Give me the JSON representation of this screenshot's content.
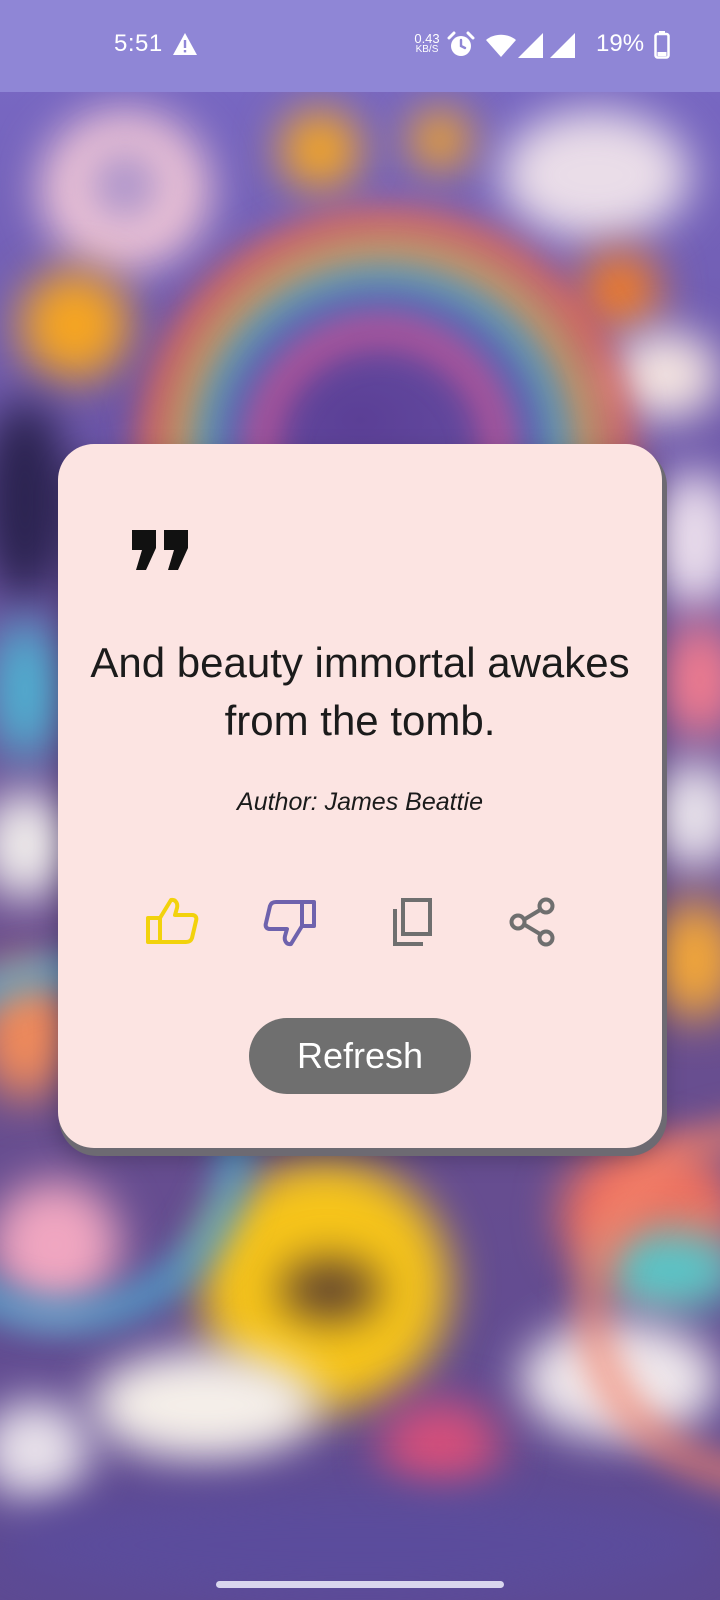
{
  "status_bar": {
    "time": "5:51",
    "net_speed_value": "0.43",
    "net_speed_unit": "KB/S",
    "battery_percent": "19%",
    "icons": [
      "warning-icon",
      "alarm-icon",
      "wifi-icon",
      "signal-icon",
      "signal-icon",
      "battery-icon"
    ]
  },
  "quote_card": {
    "quote_icon": "quote-icon",
    "quote": "And beauty immortal awakes from the tomb.",
    "author": "Author: James Beattie",
    "actions": [
      {
        "icon": "thumbs-up-icon",
        "color": "#f2d20c"
      },
      {
        "icon": "thumbs-down-icon",
        "color": "#6e62ad"
      },
      {
        "icon": "copy-icon",
        "color": "#6f6f6f"
      },
      {
        "icon": "share-icon",
        "color": "#6f6f6f"
      }
    ],
    "refresh_label": "Refresh"
  },
  "colors": {
    "card_background": "#fce4e2",
    "status_bar": "#8f86d6",
    "button": "#6f6f6f"
  }
}
